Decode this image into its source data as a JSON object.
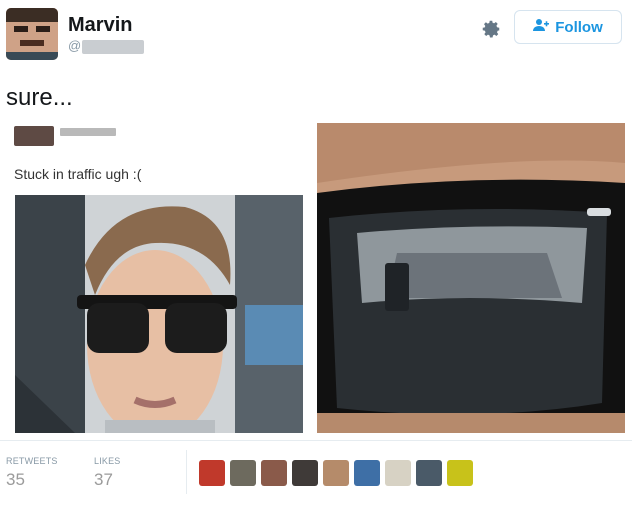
{
  "header": {
    "display_name": "Marvin",
    "handle_prefix": "@",
    "follow_label": "Follow"
  },
  "tweet": {
    "text": "sure..."
  },
  "embedded": {
    "handle_prefix": "@",
    "text": "Stuck in traffic ugh :("
  },
  "stats": {
    "retweets_label": "RETWEETS",
    "retweets_value": "35",
    "likes_label": "LIKES",
    "likes_value": "37"
  },
  "likers": [
    {
      "name": "liker-avatar-1",
      "color": "#c0392b"
    },
    {
      "name": "liker-avatar-2",
      "color": "#6d6a5e"
    },
    {
      "name": "liker-avatar-3",
      "color": "#8a5a4a"
    },
    {
      "name": "liker-avatar-4",
      "color": "#3f3a38"
    },
    {
      "name": "liker-avatar-5",
      "color": "#b58b6a"
    },
    {
      "name": "liker-avatar-6",
      "color": "#3e6fa6"
    },
    {
      "name": "liker-avatar-7",
      "color": "#d7d2c4"
    },
    {
      "name": "liker-avatar-8",
      "color": "#4a5a68"
    },
    {
      "name": "liker-avatar-9",
      "color": "#c8c21a"
    }
  ],
  "colors": {
    "accent": "#1b95e0",
    "muted": "#8899a6"
  }
}
